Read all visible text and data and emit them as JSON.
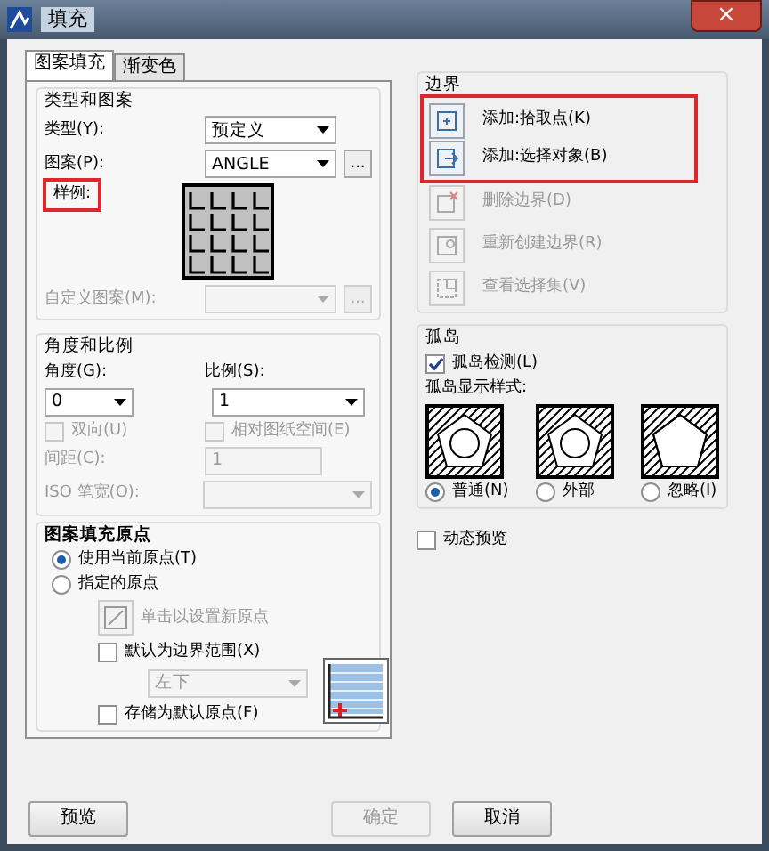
{
  "window": {
    "title": "填充",
    "close": "×"
  },
  "tabs": [
    {
      "label": "图案填充",
      "selected": true
    },
    {
      "label": "渐变色",
      "selected": false
    }
  ],
  "type_pattern": {
    "title": "类型和图案",
    "type": {
      "label": "类型(Y):",
      "value": "预定义"
    },
    "pattern": {
      "label": "图案(P):",
      "value": "ANGLE",
      "browse": "..."
    },
    "swatch": {
      "label": "样例:",
      "highlighted": true
    },
    "custom": {
      "label": "自定义图案(M):",
      "disabled": true,
      "browse": "..."
    }
  },
  "angle_scale": {
    "title": "角度和比例",
    "angle": {
      "label": "角度(G):",
      "value": "0"
    },
    "scale": {
      "label": "比例(S):",
      "value": "1"
    },
    "checks": [
      {
        "label": "双向(U)",
        "checked": false,
        "disabled": true
      },
      {
        "label": "相对图纸空间(E)",
        "checked": false,
        "disabled": true
      }
    ],
    "spacing": {
      "label": "间距(C):",
      "value": "1",
      "disabled": true
    },
    "iso": {
      "label": "ISO 笔宽(O):",
      "disabled": true
    }
  },
  "origin": {
    "title": "图案填充原点",
    "radios": [
      {
        "label": "使用当前原点(T)",
        "selected": true
      },
      {
        "label": "指定的原点",
        "selected": false
      }
    ],
    "set_new": {
      "label": "单击以设置新原点",
      "disabled": true
    },
    "default_extent": {
      "label": "默认为边界范围(X)",
      "checked": false,
      "disabled": false
    },
    "position": {
      "value": "左下",
      "disabled": true
    },
    "store_default": {
      "label": "存储为默认原点(F)",
      "checked": false,
      "disabled": false
    }
  },
  "boundary": {
    "title": "边界",
    "items": [
      {
        "label": "添加:拾取点(K)",
        "disabled": false,
        "highlighted": true
      },
      {
        "label": "添加:选择对象(B)",
        "disabled": false,
        "highlighted": true
      },
      {
        "label": "删除边界(D)",
        "disabled": true,
        "highlighted": false
      },
      {
        "label": "重新创建边界(R)",
        "disabled": true,
        "highlighted": false
      },
      {
        "label": "查看选择集(V)",
        "disabled": true,
        "highlighted": false
      }
    ]
  },
  "islands": {
    "title": "孤岛",
    "detect": {
      "label": "孤岛检测(L)",
      "checked": true
    },
    "style_label": "孤岛显示样式:",
    "styles": [
      {
        "label": "普通(N)",
        "selected": true
      },
      {
        "label": "外部",
        "selected": false
      },
      {
        "label": "忽略(I)",
        "selected": false
      }
    ]
  },
  "dynamic_preview": {
    "label": "动态预览",
    "checked": false
  },
  "buttons": [
    {
      "label": "预览",
      "disabled": false
    },
    {
      "label": "确定",
      "disabled": true
    },
    {
      "label": "取消",
      "disabled": false
    }
  ]
}
